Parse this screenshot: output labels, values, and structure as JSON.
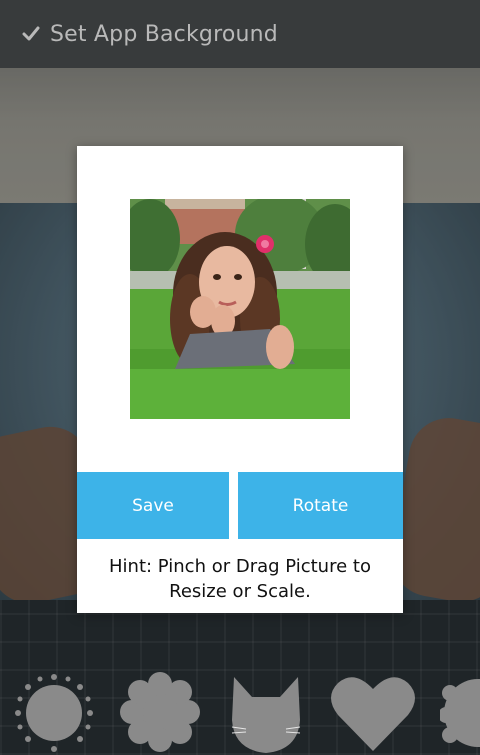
{
  "header": {
    "title": "Set App Background",
    "icon": "check-icon"
  },
  "dialog": {
    "photo_icon": "photo-preview",
    "save_label": "Save",
    "rotate_label": "Rotate",
    "hint_line1": "Hint: Pinch or Drag Picture to",
    "hint_line2": "Resize or Scale."
  },
  "shapes": [
    "sun-shape",
    "flower-shape",
    "cat-shape",
    "heart-shape",
    "partial-shape"
  ],
  "colors": {
    "accent": "#3db3e8",
    "header": "#383b3c",
    "shape": "#8a8a8a"
  }
}
